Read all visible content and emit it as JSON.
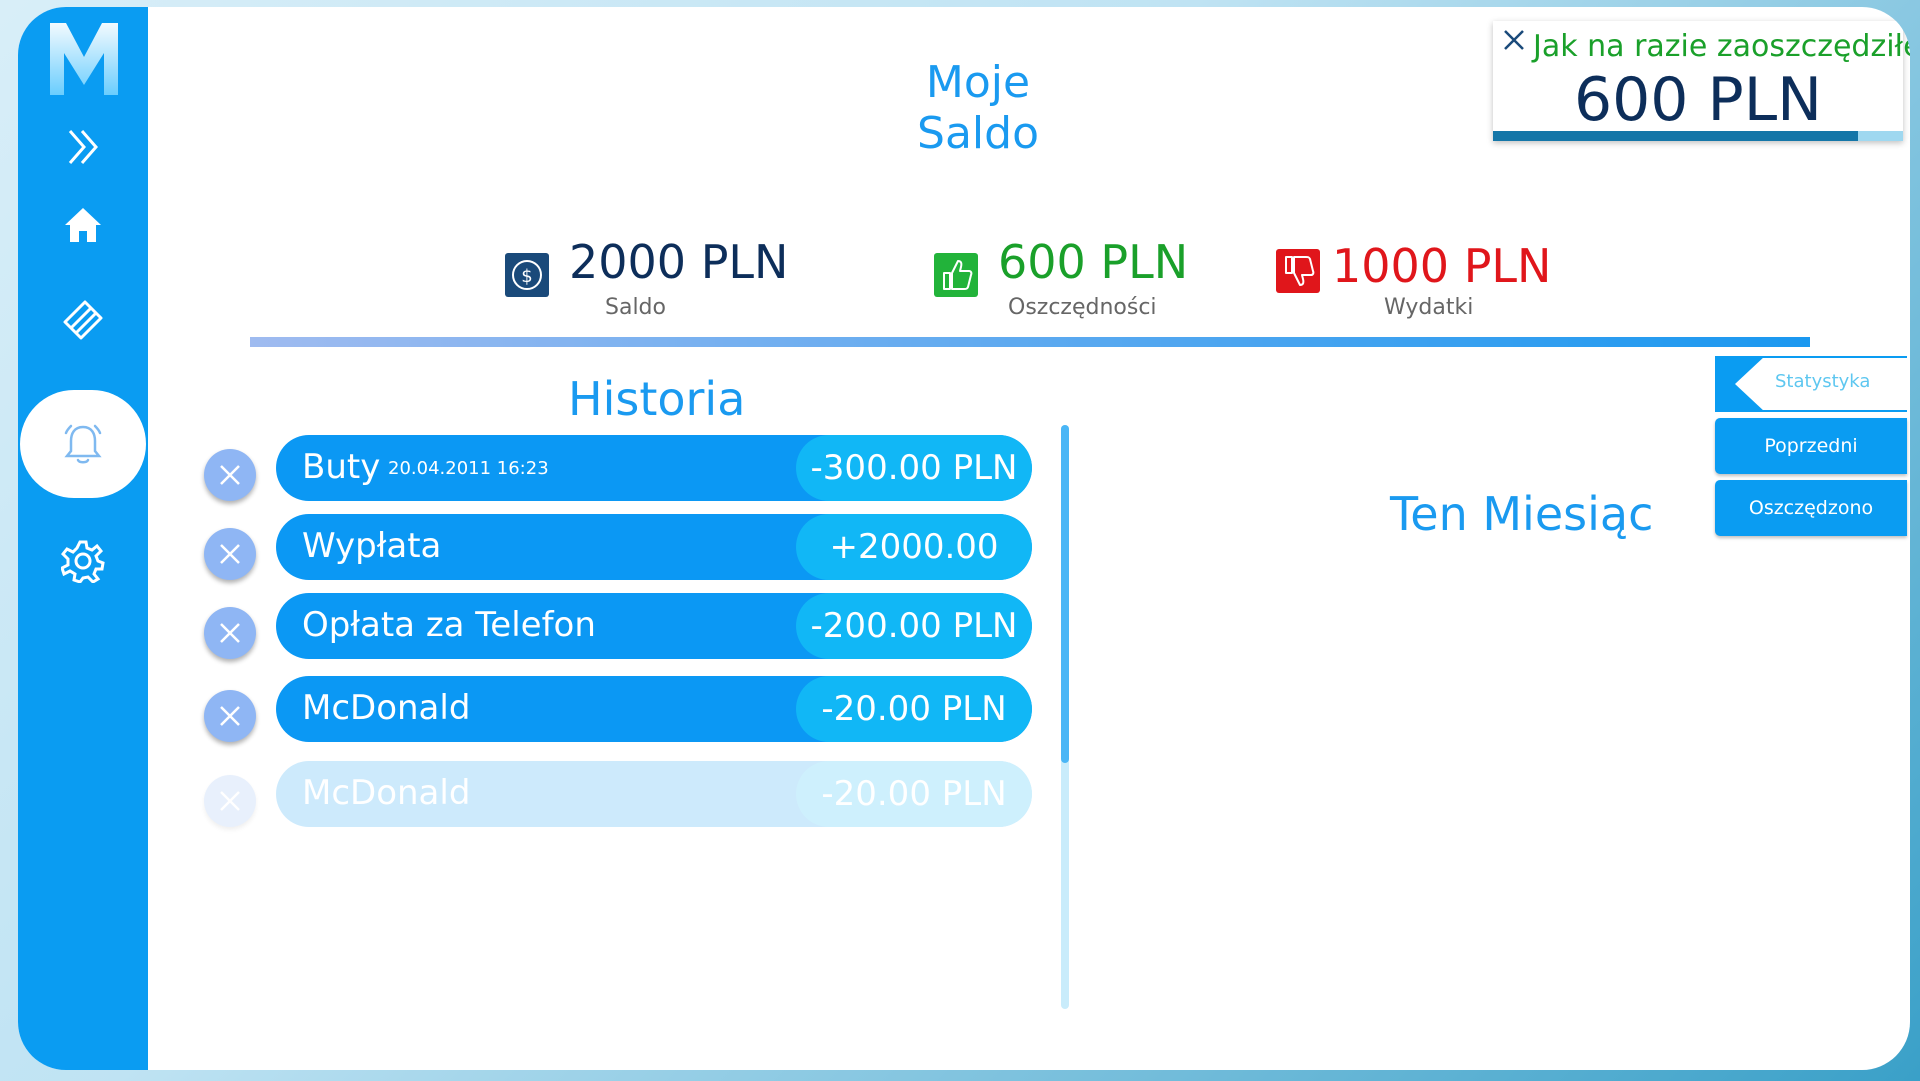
{
  "header": {
    "title": "Moje Saldo"
  },
  "notification": {
    "message": "Jak na razie zaoszczędziłeś:",
    "amount": "600 PLN",
    "progress_fraction": 0.89
  },
  "stats": {
    "saldo": {
      "value": "2000 PLN",
      "label": "Saldo",
      "color": "#0d2e5a"
    },
    "savings": {
      "value": "600 PLN",
      "label": "Oszczędności",
      "color": "#1aa02a"
    },
    "expenses": {
      "value": "1000 PLN",
      "label": "Wydatki",
      "color": "#e0161b"
    }
  },
  "history": {
    "title": "Historia",
    "items": [
      {
        "name": "Buty",
        "date": "20.04.2011 16:23",
        "amount": "-300.00 PLN"
      },
      {
        "name": "Wypłata",
        "date": "",
        "amount": "+2000.00 PLN"
      },
      {
        "name": "Opłata za Telefon",
        "date": "",
        "amount": "-200.00 PLN"
      },
      {
        "name": "McDonald",
        "date": "",
        "amount": "-20.00 PLN"
      },
      {
        "name": "McDonald",
        "date": "",
        "amount": "-20.00 PLN"
      }
    ]
  },
  "panel": {
    "title": "Ten Miesiąc"
  },
  "tabs": {
    "statystyka": "Statystyka",
    "poprzedni": "Poprzedni",
    "oszczedzono": "Oszczędzono"
  },
  "icons": {
    "sidebar": [
      "app-logo",
      "expand-icon",
      "home-icon",
      "cards-icon",
      "bell-icon",
      "gear-icon"
    ],
    "stats": [
      "dollar-icon",
      "thumbs-up-icon",
      "thumbs-down-icon"
    ]
  },
  "colors": {
    "accent": "#0a9cf2",
    "title_blue": "#1a9af0",
    "amount_pill": "#11b7f6"
  }
}
